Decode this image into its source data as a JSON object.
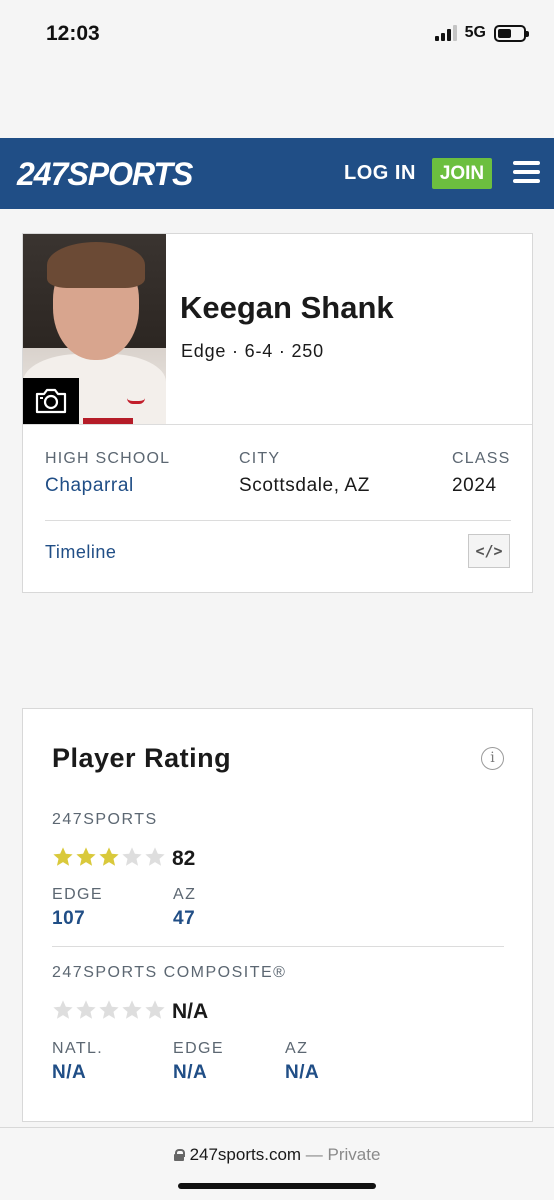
{
  "status_bar": {
    "time": "12:03",
    "network": "5G"
  },
  "header": {
    "logo_prefix": "24",
    "logo_seven": "7",
    "logo_suffix": "SPORTS",
    "login_label": "LOG IN",
    "join_label": "JOIN"
  },
  "player": {
    "name": "Keegan Shank",
    "meta": "Edge · 6-4 · 250",
    "details": [
      {
        "label": "HIGH SCHOOL",
        "value": "Chaparral"
      },
      {
        "label": "CITY",
        "value": "Scottsdale, AZ"
      },
      {
        "label": "CLASS",
        "value": "2024"
      }
    ],
    "timeline_label": "Timeline",
    "embed_label": "</>"
  },
  "rating": {
    "title": "Player Rating",
    "info_icon": "i",
    "sports247": {
      "label": "247SPORTS",
      "stars_filled": 3,
      "stars_total": 5,
      "score": "82",
      "ranks": [
        {
          "label": "EDGE",
          "value": "107"
        },
        {
          "label": "AZ",
          "value": "47"
        }
      ]
    },
    "composite": {
      "label": "247SPORTS COMPOSITE®",
      "stars_filled": 0,
      "stars_total": 5,
      "score": "N/A",
      "ranks": [
        {
          "label": "NATL.",
          "value": "N/A"
        },
        {
          "label": "EDGE",
          "value": "N/A"
        },
        {
          "label": "AZ",
          "value": "N/A"
        }
      ]
    }
  },
  "browser": {
    "domain": "247sports.com",
    "privacy": "— Private"
  },
  "colors": {
    "brand_blue": "#204e86",
    "join_green": "#6cbf3f",
    "star_gold": "#d9c93b"
  },
  "icons": [
    "signal-icon",
    "battery-icon",
    "menu-icon",
    "camera-icon",
    "info-icon",
    "star-icon",
    "lock-icon"
  ]
}
